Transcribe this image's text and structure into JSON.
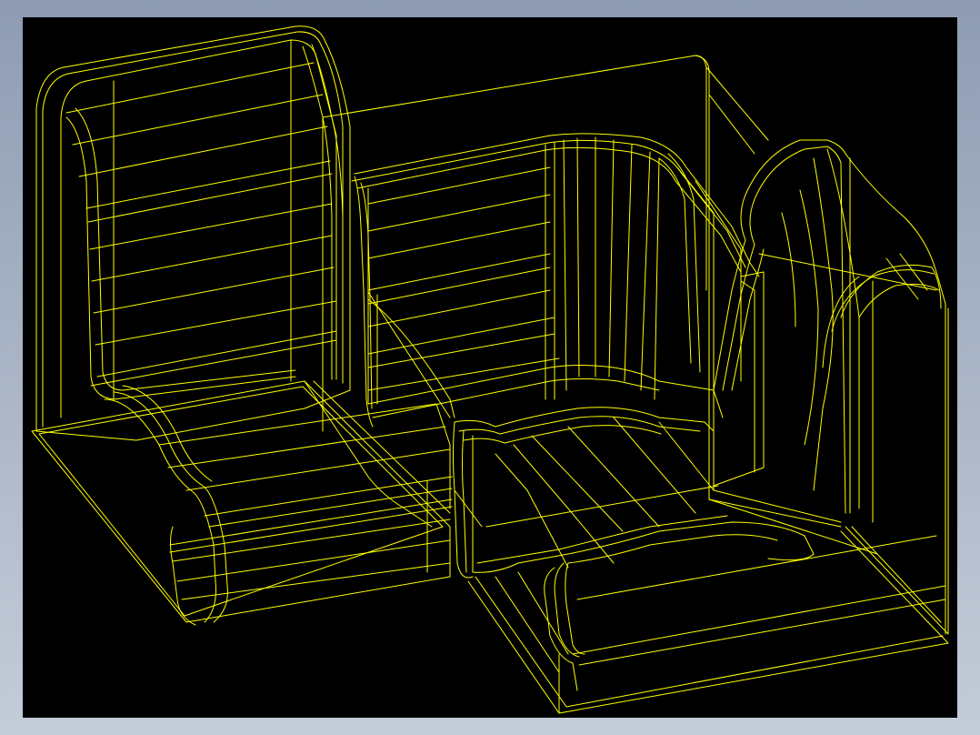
{
  "window": {
    "background_gradient_top": "#8e9cb3",
    "background_gradient_bottom": "#c4ccd8"
  },
  "viewport": {
    "background_color": "#000000",
    "wire_color": "#ffff00",
    "render_mode": "wireframe"
  },
  "model": {
    "parts": [
      "seat-back-left",
      "seat-cushion-left",
      "corner-back-panel",
      "corner-frame-box",
      "seat-back-right",
      "seat-cushion-right",
      "base-platform"
    ]
  }
}
